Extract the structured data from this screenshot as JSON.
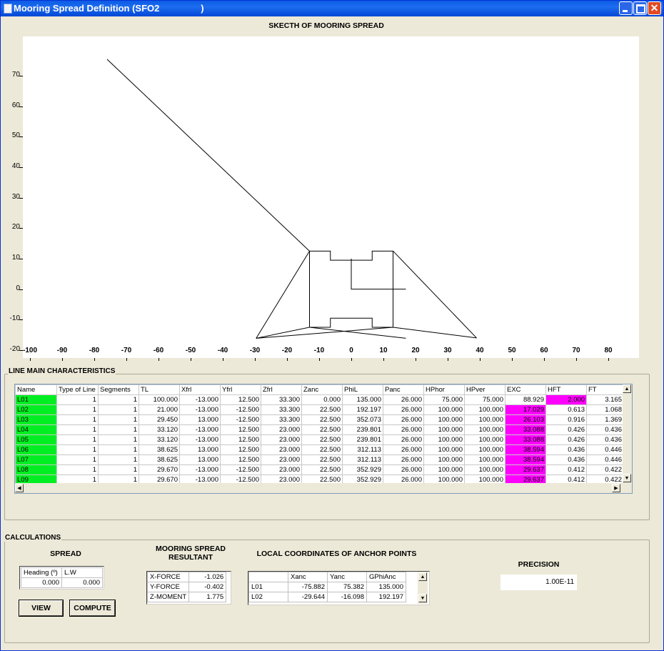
{
  "window": {
    "title": "Mooring Spread Definition (SFO2",
    "title_suffix": ")"
  },
  "sketch": {
    "title": "SKECTH OF MOORING SPREAD",
    "x_ticks": [
      "-100",
      "-90",
      "-80",
      "-70",
      "-60",
      "-50",
      "-40",
      "-30",
      "-20",
      "-10",
      "0",
      "10",
      "20",
      "30",
      "40",
      "50",
      "60",
      "70",
      "80"
    ],
    "y_ticks": [
      "70",
      "60",
      "50",
      "40",
      "30",
      "20",
      "10",
      "0",
      "-10",
      "-20"
    ],
    "xlim": [
      -100,
      80
    ],
    "ylim": [
      -20,
      70
    ]
  },
  "chart_data": {
    "type": "line",
    "title": "SKECTH OF MOORING SPREAD",
    "xlim": [
      -100,
      80
    ],
    "ylim": [
      -20,
      70
    ],
    "grid": false,
    "series": [
      {
        "values": [
          [
            -13,
            12.5
          ],
          [
            -76,
            75.4
          ]
        ]
      },
      {
        "values": [
          [
            -13,
            12.5
          ],
          [
            -13,
            -12.5
          ],
          [
            -29.6,
            -16.1
          ]
        ]
      },
      {
        "values": [
          [
            13,
            12.5
          ],
          [
            39,
            -16
          ]
        ]
      },
      {
        "values": [
          [
            -13,
            12.5
          ],
          [
            -6.5,
            12.5
          ],
          [
            -6.5,
            9.5
          ],
          [
            6.5,
            9.5
          ],
          [
            6.5,
            12.5
          ],
          [
            13,
            12.5
          ],
          [
            13,
            -12.5
          ]
        ]
      },
      {
        "values": [
          [
            -13,
            -12.5
          ],
          [
            -6.5,
            -12.5
          ],
          [
            -6.5,
            -9.5
          ],
          [
            6.5,
            -9.5
          ],
          [
            6.5,
            -12.5
          ],
          [
            13,
            -12.5
          ]
        ]
      },
      {
        "values": [
          [
            0,
            10
          ],
          [
            0,
            0
          ],
          [
            17,
            0
          ]
        ]
      },
      {
        "values": [
          [
            -29.6,
            -16.1
          ],
          [
            13,
            -12.5
          ],
          [
            39,
            -16
          ]
        ]
      },
      {
        "values": [
          [
            -13,
            -12.5
          ],
          [
            17,
            -16.1
          ]
        ]
      },
      {
        "values": [
          [
            -29.6,
            -16.1
          ],
          [
            -13,
            12.5
          ]
        ]
      }
    ]
  },
  "line_main": {
    "title": "LINE MAIN CHARACTERISTICS",
    "columns": [
      "Name",
      "Type of Line",
      "Segments",
      "TL",
      "Xfrl",
      "Yfrl",
      "Zfrl",
      "Zanc",
      "PhiL",
      "Panc",
      "HPhor",
      "HPver",
      "EXC",
      "HFT",
      "FT"
    ],
    "rows": [
      [
        "L01",
        "1",
        "1",
        "100.000",
        "-13.000",
        "12.500",
        "33.300",
        "0.000",
        "135.000",
        "26.000",
        "75.000",
        "75.000",
        "88.929",
        "2.000",
        "3.165"
      ],
      [
        "L02",
        "1",
        "1",
        "21.000",
        "-13.000",
        "-12.500",
        "33.300",
        "22.500",
        "192.197",
        "26.000",
        "100.000",
        "100.000",
        "17.029",
        "0.613",
        "1.068"
      ],
      [
        "L03",
        "1",
        "1",
        "29.450",
        "13.000",
        "-12.500",
        "33.300",
        "22.500",
        "352.073",
        "26.000",
        "100.000",
        "100.000",
        "26.103",
        "0.916",
        "1.369"
      ],
      [
        "L04",
        "1",
        "1",
        "33.120",
        "-13.000",
        "12.500",
        "23.000",
        "22.500",
        "239.801",
        "26.000",
        "100.000",
        "100.000",
        "33.088",
        "0.426",
        "0.436"
      ],
      [
        "L05",
        "1",
        "1",
        "33.120",
        "-13.000",
        "12.500",
        "23.000",
        "22.500",
        "239.801",
        "26.000",
        "100.000",
        "100.000",
        "33.088",
        "0.426",
        "0.436"
      ],
      [
        "L06",
        "1",
        "1",
        "38.625",
        "13.000",
        "12.500",
        "23.000",
        "22.500",
        "312.113",
        "26.000",
        "100.000",
        "100.000",
        "38.594",
        "0.436",
        "0.446"
      ],
      [
        "L07",
        "1",
        "1",
        "38.625",
        "13.000",
        "12.500",
        "23.000",
        "22.500",
        "312.113",
        "26.000",
        "100.000",
        "100.000",
        "38.594",
        "0.436",
        "0.446"
      ],
      [
        "L08",
        "1",
        "1",
        "29.670",
        "-13.000",
        "-12.500",
        "23.000",
        "22.500",
        "352.929",
        "26.000",
        "100.000",
        "100.000",
        "29.637",
        "0.412",
        "0.422"
      ],
      [
        "L09",
        "1",
        "1",
        "29.670",
        "-13.000",
        "-12.500",
        "23.000",
        "22.500",
        "352.929",
        "26.000",
        "100.000",
        "100.000",
        "29.637",
        "0.412",
        "0.422"
      ]
    ],
    "highlight_colors": {
      "name": "#00ee22",
      "exc": "#ff00ff"
    }
  },
  "calculations": {
    "title": "CALCULATIONS",
    "spread": {
      "label": "SPREAD",
      "headers": [
        "Heading (º)",
        "L.W"
      ],
      "values": [
        "0.000",
        "0.000"
      ],
      "view_button": "VIEW",
      "compute_button": "COMPUTE"
    },
    "resultant": {
      "label_line1": "MOORING SPREAD",
      "label_line2": "RESULTANT",
      "rows": [
        [
          "X-FORCE",
          "-1.026"
        ],
        [
          "Y-FORCE",
          "-0.402"
        ],
        [
          "Z-MOMENT",
          "1.775"
        ]
      ]
    },
    "anchors": {
      "label": "LOCAL COORDINATES OF ANCHOR POINTS",
      "headers": [
        "",
        "Xanc",
        "Yanc",
        "GPhiAnc"
      ],
      "rows": [
        [
          "L01",
          "-75.882",
          "75.382",
          "135.000"
        ],
        [
          "L02",
          "-29.644",
          "-16.098",
          "192.197"
        ]
      ]
    },
    "precision": {
      "label": "PRECISION",
      "value": "1.00E-11"
    }
  }
}
